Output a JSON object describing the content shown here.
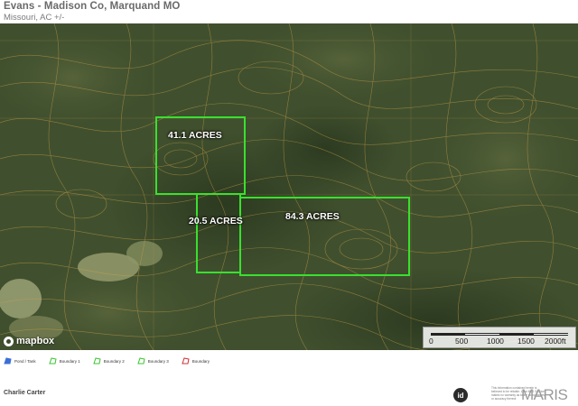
{
  "header": {
    "title": "Evans - Madison Co, Marquand MO",
    "subtitle": "Missouri,  AC +/-"
  },
  "map": {
    "attribution": "mapbox",
    "parcels": [
      {
        "label": "41.1 ACRES"
      },
      {
        "label": "20.5 ACRES"
      },
      {
        "label": "84.3 ACRES"
      }
    ],
    "boundary_color": "#39e02f",
    "scale_bar": {
      "ticks": [
        "0",
        "500",
        "1000",
        "1500",
        "2000ft"
      ]
    }
  },
  "legend": {
    "items": [
      {
        "label": "Pond / Tank",
        "color": "#3b6fd6",
        "icon": "pond-icon"
      },
      {
        "label": "Boundary 1",
        "color": "#39c52f",
        "icon": "boundary-icon"
      },
      {
        "label": "Boundary 2",
        "color": "#39c52f",
        "icon": "boundary-icon"
      },
      {
        "label": "Boundary 3",
        "color": "#39c52f",
        "icon": "boundary-icon"
      },
      {
        "label": "Boundary",
        "color": "#d03030",
        "icon": "boundary-icon"
      }
    ]
  },
  "footer": {
    "agent_name": "Charlie Carter",
    "disclaimer": "This information contained herein is believed to be reliable. Land MLS Services makes no warranty as to the completeness or accuracy thereof.",
    "id_badge": "id",
    "mls_logo": "MARIS"
  }
}
